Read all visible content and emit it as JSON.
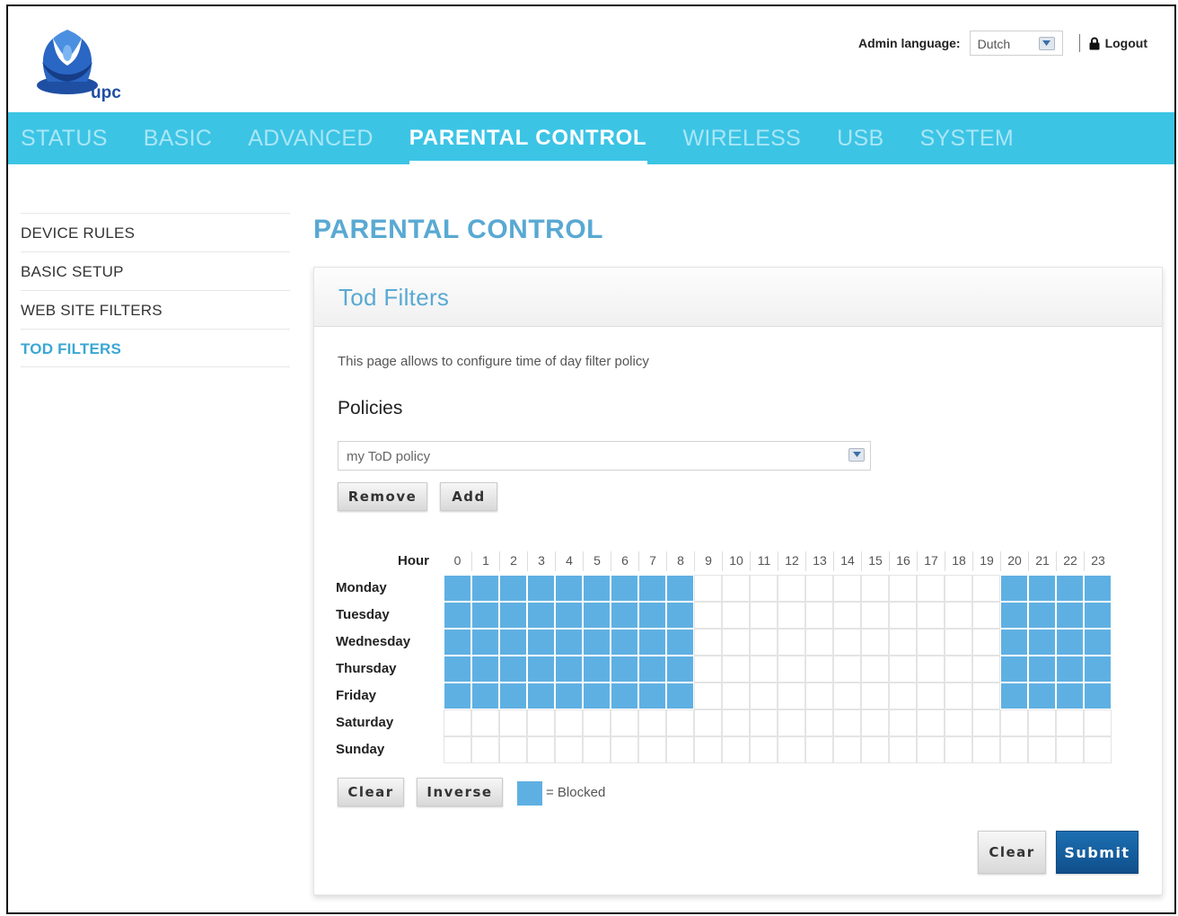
{
  "header": {
    "logo_text": "upc",
    "admin_language_label": "Admin language:",
    "admin_language_value": "Dutch",
    "logout_label": "Logout"
  },
  "nav": {
    "items": [
      {
        "label": "STATUS"
      },
      {
        "label": "BASIC"
      },
      {
        "label": "ADVANCED"
      },
      {
        "label": "PARENTAL CONTROL",
        "active": true
      },
      {
        "label": "WIRELESS"
      },
      {
        "label": "USB"
      },
      {
        "label": "SYSTEM"
      }
    ]
  },
  "sidebar": {
    "items": [
      {
        "label": "DEVICE RULES"
      },
      {
        "label": "BASIC SETUP"
      },
      {
        "label": "WEB SITE FILTERS"
      },
      {
        "label": "TOD FILTERS",
        "active": true
      }
    ]
  },
  "page": {
    "title": "PARENTAL CONTROL",
    "panel_title": "Tod Filters",
    "description": "This page allows to configure time of day filter policy",
    "policies_label": "Policies",
    "policy_selected": "my ToD policy",
    "remove_label": "Remove",
    "add_label": "Add",
    "clear_label": "Clear",
    "inverse_label": "Inverse",
    "legend_label": "= Blocked",
    "bottom_clear_label": "Clear",
    "submit_label": "Submit"
  },
  "schedule": {
    "hour_label": "Hour",
    "hours": [
      "0",
      "1",
      "2",
      "3",
      "4",
      "5",
      "6",
      "7",
      "8",
      "9",
      "10",
      "11",
      "12",
      "13",
      "14",
      "15",
      "16",
      "17",
      "18",
      "19",
      "20",
      "21",
      "22",
      "23"
    ],
    "days": [
      "Monday",
      "Tuesday",
      "Wednesday",
      "Thursday",
      "Friday",
      "Saturday",
      "Sunday"
    ],
    "blocked": [
      [
        1,
        1,
        1,
        1,
        1,
        1,
        1,
        1,
        1,
        0,
        0,
        0,
        0,
        0,
        0,
        0,
        0,
        0,
        0,
        0,
        1,
        1,
        1,
        1
      ],
      [
        1,
        1,
        1,
        1,
        1,
        1,
        1,
        1,
        1,
        0,
        0,
        0,
        0,
        0,
        0,
        0,
        0,
        0,
        0,
        0,
        1,
        1,
        1,
        1
      ],
      [
        1,
        1,
        1,
        1,
        1,
        1,
        1,
        1,
        1,
        0,
        0,
        0,
        0,
        0,
        0,
        0,
        0,
        0,
        0,
        0,
        1,
        1,
        1,
        1
      ],
      [
        1,
        1,
        1,
        1,
        1,
        1,
        1,
        1,
        1,
        0,
        0,
        0,
        0,
        0,
        0,
        0,
        0,
        0,
        0,
        0,
        1,
        1,
        1,
        1
      ],
      [
        1,
        1,
        1,
        1,
        1,
        1,
        1,
        1,
        1,
        0,
        0,
        0,
        0,
        0,
        0,
        0,
        0,
        0,
        0,
        0,
        1,
        1,
        1,
        1
      ],
      [
        0,
        0,
        0,
        0,
        0,
        0,
        0,
        0,
        0,
        0,
        0,
        0,
        0,
        0,
        0,
        0,
        0,
        0,
        0,
        0,
        0,
        0,
        0,
        0
      ],
      [
        0,
        0,
        0,
        0,
        0,
        0,
        0,
        0,
        0,
        0,
        0,
        0,
        0,
        0,
        0,
        0,
        0,
        0,
        0,
        0,
        0,
        0,
        0,
        0
      ]
    ]
  },
  "colors": {
    "nav_bg": "#3cc4e5",
    "accent": "#59a9d3",
    "blocked": "#5fb0e2",
    "submit": "#0f4f8b"
  }
}
